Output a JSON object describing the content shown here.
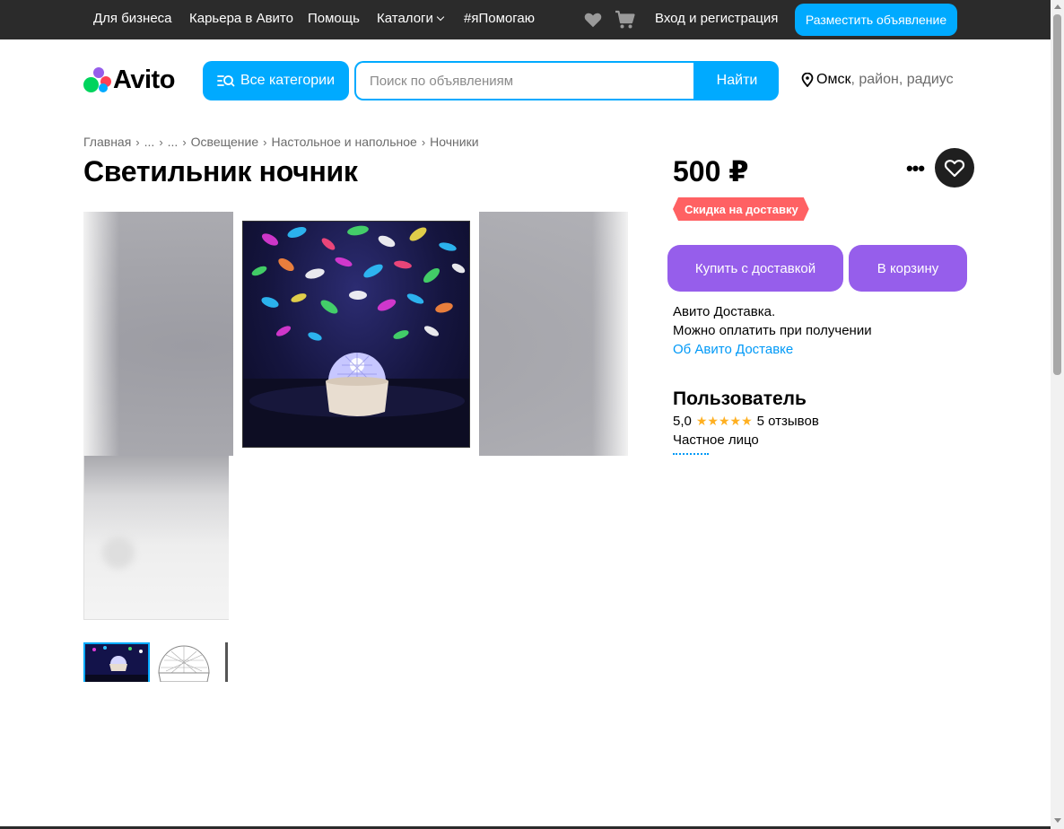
{
  "topbar": {
    "links": [
      "Для бизнеса",
      "Карьера в Авито",
      "Помощь",
      "Каталоги",
      "#яПомогаю"
    ],
    "login": "Вход и регистрация",
    "post_ad": "Разместить объявление"
  },
  "header": {
    "logo": "Avito",
    "categories_button": "Все категории",
    "search_placeholder": "Поиск по объявлениям",
    "search_button": "Найти",
    "location_city": "Омск",
    "location_rest": ", район, радиус"
  },
  "breadcrumb": [
    "Главная",
    "...",
    "...",
    "Освещение",
    "Настольное и напольное",
    "Ночники"
  ],
  "listing": {
    "title": "Светильник ночник",
    "price": "500 ₽",
    "discount_badge": "Скидка на доставку",
    "buy_button": "Купить с доставкой",
    "cart_button": "В корзину",
    "delivery_line1": "Авито Доставка.",
    "delivery_line2": "Можно оплатить при получении",
    "delivery_link": "Об Авито Доставке"
  },
  "seller": {
    "name": "Пользователь",
    "rating": "5,0",
    "stars": 5,
    "reviews": "5 отзывов",
    "type": "Частное лицо"
  },
  "icons": {
    "favorites": "heart-icon",
    "cart": "cart-icon",
    "location": "location-pin-icon",
    "more": "more-dots-icon",
    "search": "search-icon"
  },
  "colors": {
    "accent_blue": "#00aaff",
    "purple": "#965eeb",
    "badge_red": "#ff6163",
    "star": "#ffb021",
    "link": "#0099f7"
  }
}
